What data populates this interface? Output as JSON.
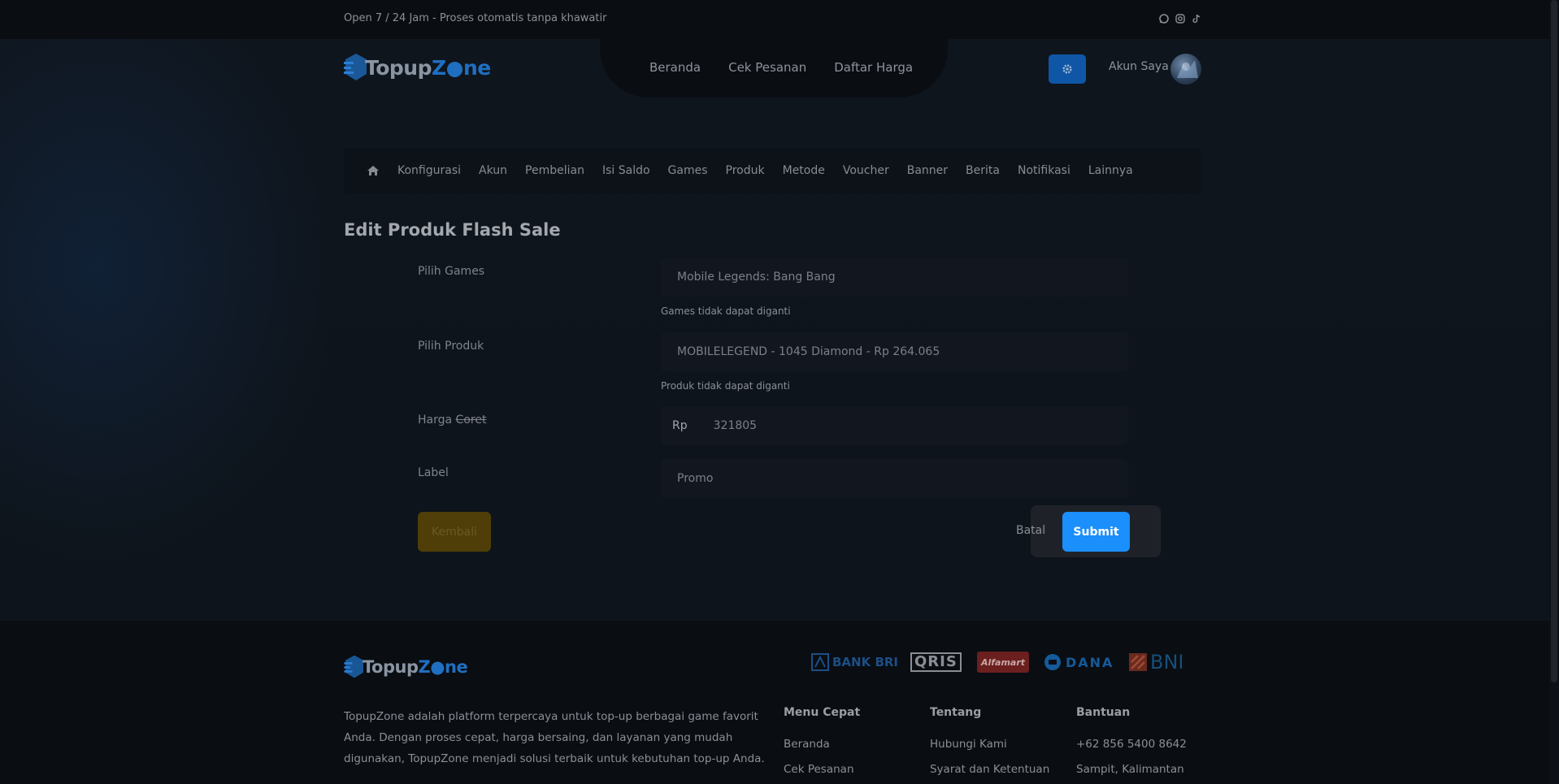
{
  "topbar": {
    "tagline": "Open 7 / 24 Jam - Proses otomatis tanpa khawatir",
    "socials": [
      "whatsapp-icon",
      "instagram-icon",
      "tiktok-icon"
    ]
  },
  "brand": {
    "name_part1": "Topup",
    "name_z": "Z",
    "name_part2": "ne"
  },
  "nav": {
    "items": [
      "Beranda",
      "Cek Pesanan",
      "Daftar Harga"
    ]
  },
  "account": {
    "label": "Akun Saya"
  },
  "subnav": {
    "items": [
      "Konfigurasi",
      "Akun",
      "Pembelian",
      "Isi Saldo",
      "Games",
      "Produk",
      "Metode",
      "Voucher",
      "Banner",
      "Berita",
      "Notifikasi",
      "Lainnya"
    ]
  },
  "page": {
    "title": "Edit Produk Flash Sale"
  },
  "form": {
    "games_label": "Pilih Games",
    "games_value": "Mobile Legends: Bang Bang",
    "games_hint": "Games tidak dapat diganti",
    "product_label": "Pilih Produk",
    "product_value": "MOBILELEGEND - 1045 Diamond - Rp 264.065",
    "product_hint": "Produk tidak dapat diganti",
    "price_label_a": "Harga",
    "price_label_b": "Coret",
    "price_prefix": "Rp",
    "price_value": "321805",
    "label_label": "Label",
    "label_value": "Promo"
  },
  "buttons": {
    "back": "Kembali",
    "cancel": "Batal",
    "submit": "Submit"
  },
  "footer": {
    "description": "TopupZone adalah platform terpercaya untuk top-up berbagai game favorit Anda. Dengan proses cepat, harga bersaing, dan layanan yang mudah digunakan, TopupZone menjadi solusi terbaik untuk kebutuhan top-up Anda.",
    "payments": [
      "BANK BRI",
      "QRIS",
      "Alfamart",
      "DANA",
      "BNI"
    ],
    "col1": {
      "title": "Menu Cepat",
      "items": [
        "Beranda",
        "Cek Pesanan"
      ]
    },
    "col2": {
      "title": "Tentang",
      "items": [
        "Hubungi Kami",
        "Syarat dan Ketentuan"
      ]
    },
    "col3": {
      "title": "Bantuan",
      "items": [
        "+62 856 5400 8642",
        "Sampit, Kalimantan"
      ]
    }
  },
  "colors": {
    "accent": "#1b8ffb",
    "back_button": "#4f3e07",
    "gear_button": "#0f56a6"
  }
}
